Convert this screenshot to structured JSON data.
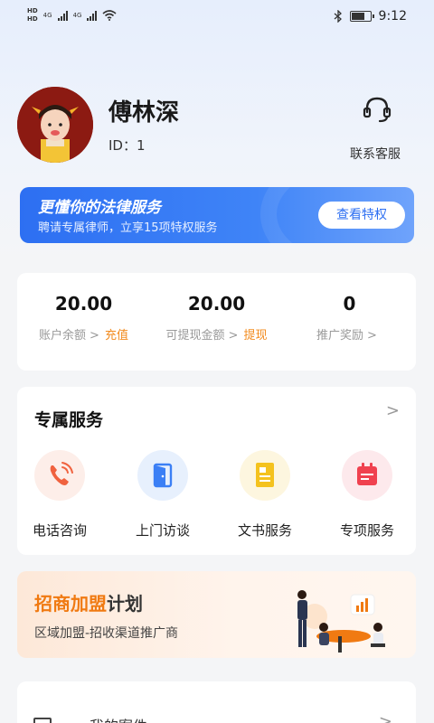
{
  "status_bar": {
    "hd_top": "HD",
    "hd_bottom": "HD",
    "net_1": "4G",
    "net_2": "4G",
    "time": "9:12",
    "battery_level": 0.75
  },
  "profile": {
    "name": "傅林深",
    "id_text": "ID：1",
    "customer_service_label": "联系客服"
  },
  "banner": {
    "title": "更懂你的法律服务",
    "subtitle": "聘请专属律师，立享15项特权服务",
    "button_label": "查看特权"
  },
  "stats": [
    {
      "value": "20.00",
      "label": "账户余额",
      "action": "充值"
    },
    {
      "value": "20.00",
      "label": "可提现金额",
      "action": "提现"
    },
    {
      "value": "0",
      "label": "推广奖励",
      "action": ""
    }
  ],
  "services": {
    "title": "专属服务",
    "items": [
      {
        "label": "电话咨询",
        "icon": "phone-icon",
        "bg": "#fdeee9",
        "color": "#f0623f"
      },
      {
        "label": "上门访谈",
        "icon": "door-icon",
        "bg": "#e7f0fd",
        "color": "#3b7ff5"
      },
      {
        "label": "文书服务",
        "icon": "document-icon",
        "bg": "#fdf6df",
        "color": "#f4c21e"
      },
      {
        "label": "专项服务",
        "icon": "calendar-icon",
        "bg": "#fde9ec",
        "color": "#f0414f"
      }
    ]
  },
  "promo": {
    "title_highlight": "招商加盟",
    "title_rest": "计划",
    "subtitle": "区域加盟-招收渠道推广商"
  },
  "my_case": {
    "label": "我的案件"
  },
  "colors": {
    "primary_blue": "#2d6ff2",
    "accent_orange": "#f28a1c"
  }
}
